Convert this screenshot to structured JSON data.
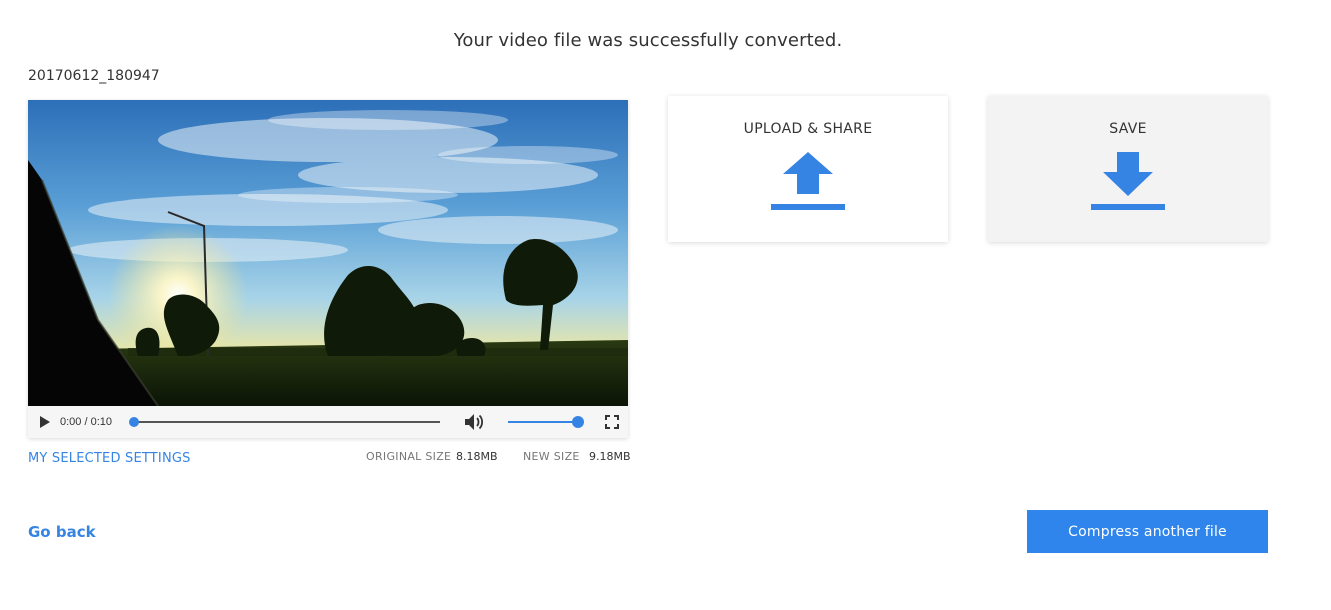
{
  "headline": "Your video file was successfully converted.",
  "file": {
    "name": "20170612_180947"
  },
  "player": {
    "current_time": "0:00",
    "separator": " / ",
    "duration": "0:10",
    "progress_fraction": 0.0,
    "volume_fraction": 1.0,
    "icons": {
      "play": "play-icon",
      "volume": "volume-icon",
      "fullscreen": "fullscreen-icon"
    }
  },
  "settings": {
    "link_label": "MY SELECTED SETTINGS",
    "original_size_label": "ORIGINAL SIZE",
    "original_size_value": "8.18MB",
    "new_size_label": "NEW SIZE",
    "new_size_value": "9.18MB"
  },
  "actions": {
    "upload_share_label": "UPLOAD & SHARE",
    "save_label": "SAVE",
    "upload_icon": "upload-icon",
    "download_icon": "download-icon"
  },
  "footer": {
    "go_back_label": "Go back",
    "compress_label": "Compress another file"
  },
  "colors": {
    "accent": "#3584e4",
    "button": "#2f85ec",
    "text": "#333333",
    "muted": "#777777"
  }
}
